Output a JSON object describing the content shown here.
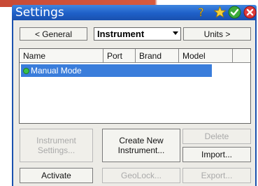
{
  "window": {
    "title": "Settings"
  },
  "icons": {
    "help": "help-question-icon",
    "star": "favorite-star-icon",
    "ok": "ok-check-icon",
    "close": "close-x-icon"
  },
  "nav": {
    "prev_label": "< General",
    "next_label": "Units >",
    "dropdown_value": "Instrument"
  },
  "table": {
    "columns": [
      "Name",
      "Port",
      "Brand",
      "Model"
    ],
    "rows": [
      {
        "name": "Manual Mode",
        "port": "",
        "brand": "",
        "model": "",
        "selected": true,
        "status_color": "#3ac04a"
      }
    ]
  },
  "buttons": {
    "instrument_settings": {
      "line1": "Instrument",
      "line2": "Settings...",
      "enabled": false
    },
    "create_new": {
      "line1": "Create New",
      "line2": "Instrument...",
      "enabled": true
    },
    "delete": {
      "label": "Delete",
      "enabled": false
    },
    "import": {
      "label": "Import...",
      "enabled": true
    },
    "activate": {
      "label": "Activate",
      "enabled": true
    },
    "geolock": {
      "label": "GeoLock...",
      "enabled": false
    },
    "export": {
      "label": "Export...",
      "enabled": false
    }
  },
  "colors": {
    "titlebar": "#1e5fc8",
    "selection": "#3a7ddb",
    "panel": "#ecebe6"
  }
}
